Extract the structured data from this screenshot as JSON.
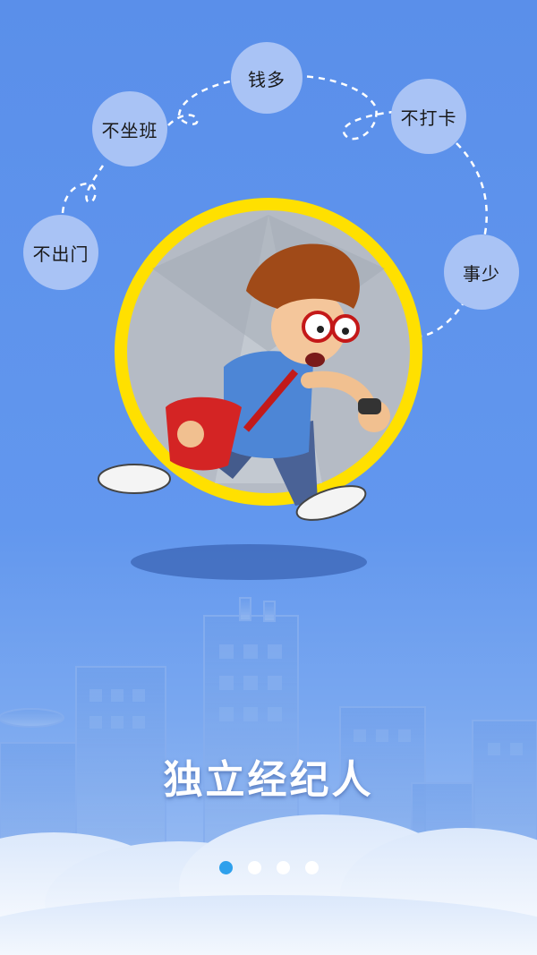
{
  "bubbles": {
    "chumen": "不出门",
    "zuoban": "不坐班",
    "qianduo": "钱多",
    "daka": "不打卡",
    "shishao": "事少"
  },
  "title": "独立经纪人",
  "pager": {
    "page": 1,
    "total": 4
  },
  "colors": {
    "background": "#5e93ec",
    "bubble": "#a9c3f5",
    "ring": "#ffe000",
    "active_dot": "#2ea0ec",
    "inactive_dot": "#ffffff"
  }
}
